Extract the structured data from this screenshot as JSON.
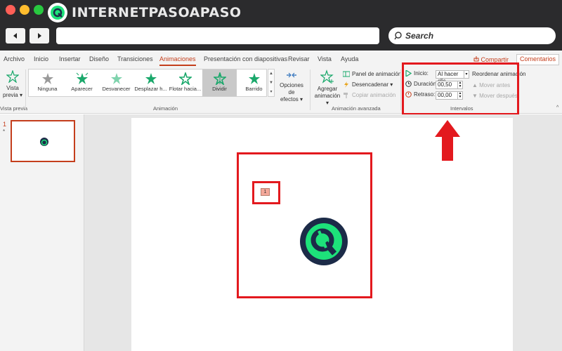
{
  "brand": {
    "prefix": "INTERNET",
    "suffix": "PASOAPASO"
  },
  "browser": {
    "back_icon": "left-arrow-icon",
    "forward_icon": "right-arrow-icon",
    "search_placeholder": "Search"
  },
  "ribbon": {
    "tabs": [
      "Archivo",
      "Inicio",
      "Insertar",
      "Diseño",
      "Transiciones",
      "Animaciones",
      "Presentación con diapositivas",
      "Revisar",
      "Vista",
      "Ayuda"
    ],
    "active_tab": "Animaciones",
    "share_label": "Compartir",
    "comments_label": "Comentarios",
    "preview": {
      "line1": "Vista",
      "line2": "previa",
      "group_label": "Vista previa"
    },
    "gallery": [
      "Ninguna",
      "Aparecer",
      "Desvanecer",
      "Desplazar h...",
      "Flotar hacia...",
      "Dividir",
      "Barrido"
    ],
    "gallery_selected": "Dividir",
    "effect_options": {
      "line1": "Opciones de",
      "line2": "efectos"
    },
    "animation_group_label": "Animación",
    "add_animation": {
      "line1": "Agregar",
      "line2": "animación"
    },
    "advanced": {
      "panel": "Panel de animación",
      "trigger": "Desencadenar",
      "copy": "Copiar animación",
      "group_label": "Animación avanzada"
    },
    "timing": {
      "start_label": "Inicio:",
      "start_value": "Al hacer clic",
      "duration_label": "Duración:",
      "duration_value": "00,50",
      "delay_label": "Retraso:",
      "delay_value": "00,00",
      "reorder_title": "Reordenar animación",
      "move_earlier": "Mover antes",
      "move_later": "Mover después",
      "group_label": "Intervalos"
    }
  },
  "slides": {
    "thumb_number": "1",
    "thumb_marker": "*",
    "animation_tag": "1"
  },
  "colors": {
    "accent": "#c43e1c",
    "highlight": "#e3191e",
    "logo_green": "#1de27a",
    "logo_navy": "#1c2b48"
  }
}
